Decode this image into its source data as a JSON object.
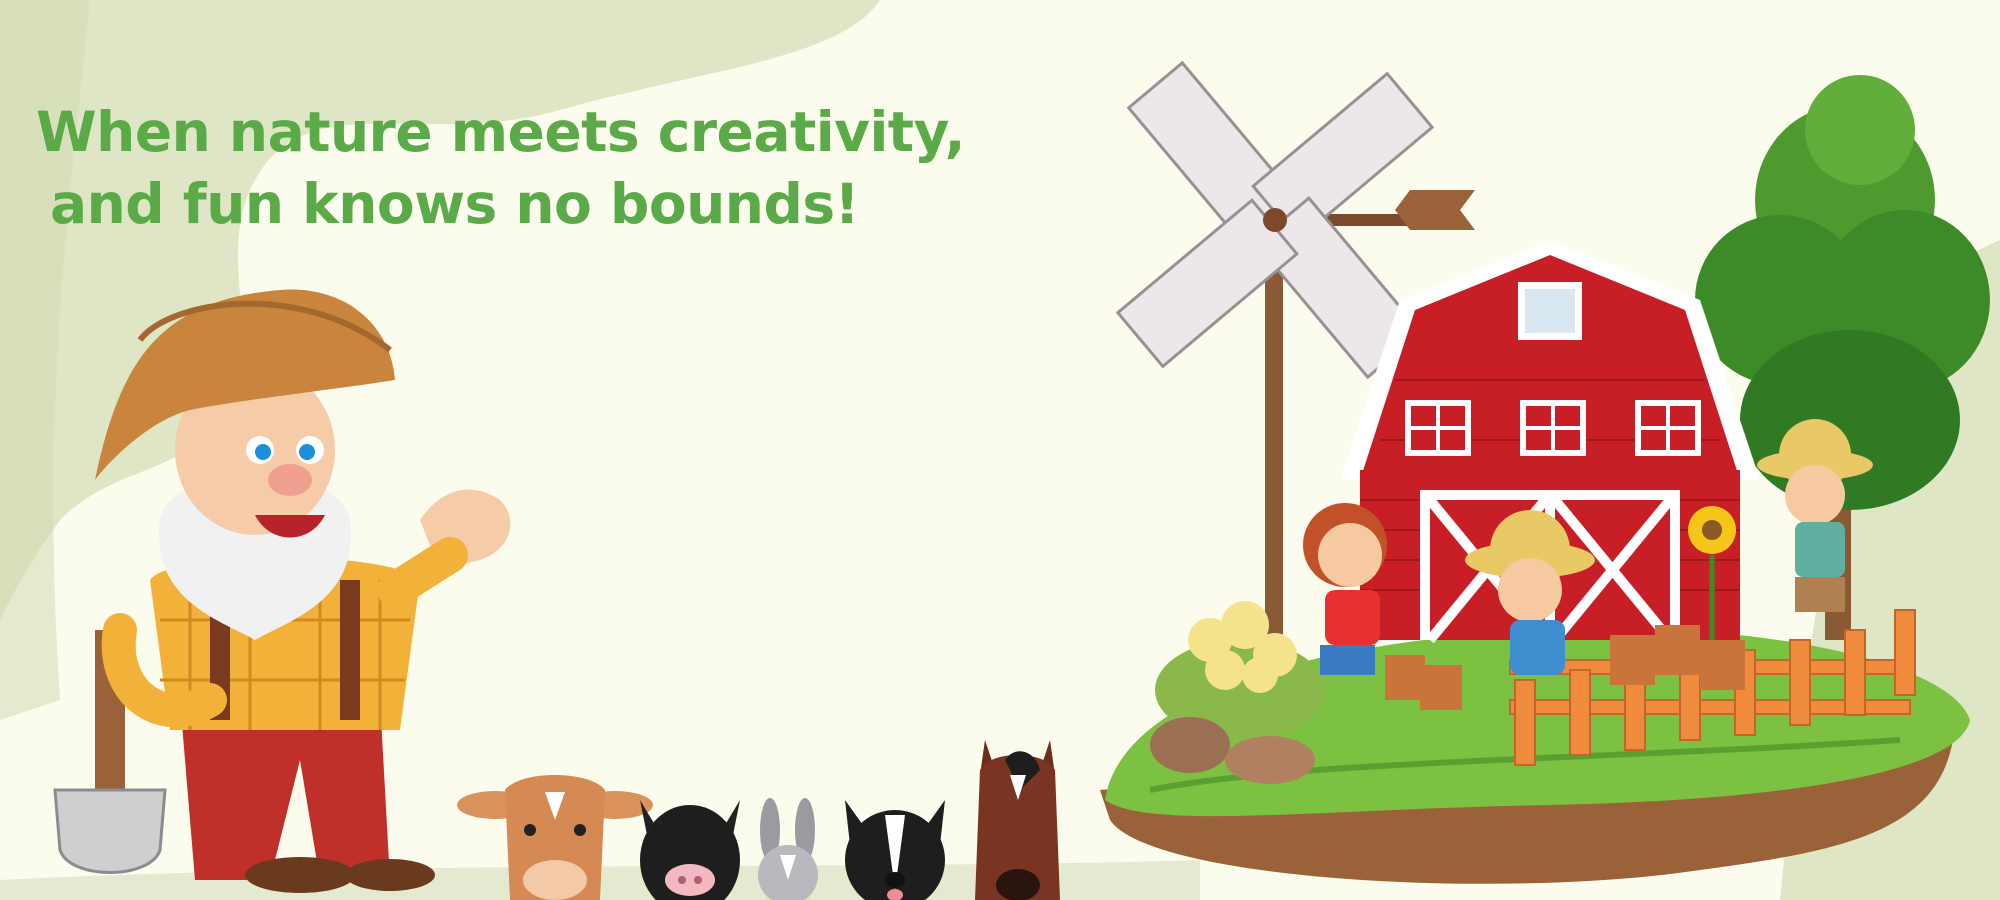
{
  "headline": {
    "line1": "When nature meets creativity,",
    "line2": "and fun knows no bounds!"
  },
  "colors": {
    "background": "#fbfbee",
    "blob": "#dfe6c6",
    "headline": "#5aaa48",
    "barn": "#c81e26",
    "grass": "#7cc142",
    "soil": "#9a6238"
  },
  "icons": [
    "farmer-illustration",
    "windmill-illustration",
    "barn-illustration",
    "tree-illustration",
    "fence-illustration",
    "cow-icon",
    "pig-icon",
    "rabbit-icon",
    "dog-icon",
    "horse-icon",
    "children-gardening-illustration"
  ]
}
